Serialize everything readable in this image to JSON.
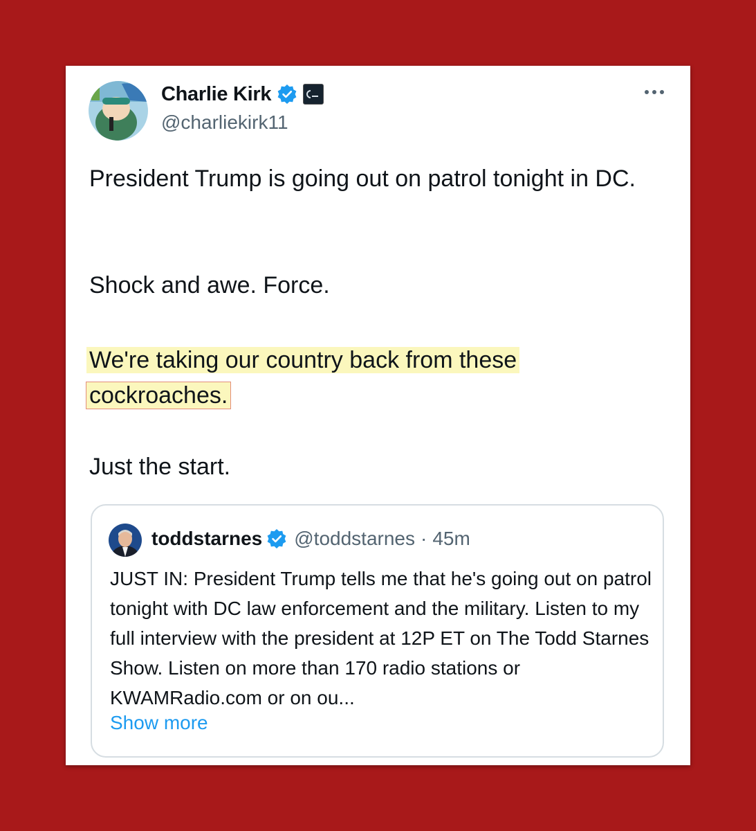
{
  "tweet": {
    "author_name": "Charlie Kirk",
    "author_handle": "@charliekirk11",
    "paragraph_1": "President Trump is going out on patrol tonight in DC.",
    "paragraph_2": "Shock and awe. Force.",
    "paragraph_3_line1": "We're taking our country back from these",
    "paragraph_3_line2": "cockroaches.",
    "paragraph_4": "Just the start."
  },
  "quoted_tweet": {
    "author_name": "toddstarnes",
    "author_handle": "@toddstarnes",
    "separator": "·",
    "time": "45m",
    "text": "JUST IN: President Trump tells me that he's going out on patrol tonight with DC law enforcement and the military. Listen to my full interview with the president at 12P ET on The Todd Starnes Show. Listen on more than 170 radio stations or KWAMRadio.com or on ou...",
    "show_more_label": "Show more"
  },
  "icons": {
    "verified": "verified-badge-icon",
    "affiliation": "affiliation-badge-icon",
    "more": "more-options-icon"
  },
  "colors": {
    "background": "#a8191a",
    "verified_blue": "#1d9bf0",
    "highlight": "#fbf7bd",
    "highlight_box": "#e38d7a"
  }
}
